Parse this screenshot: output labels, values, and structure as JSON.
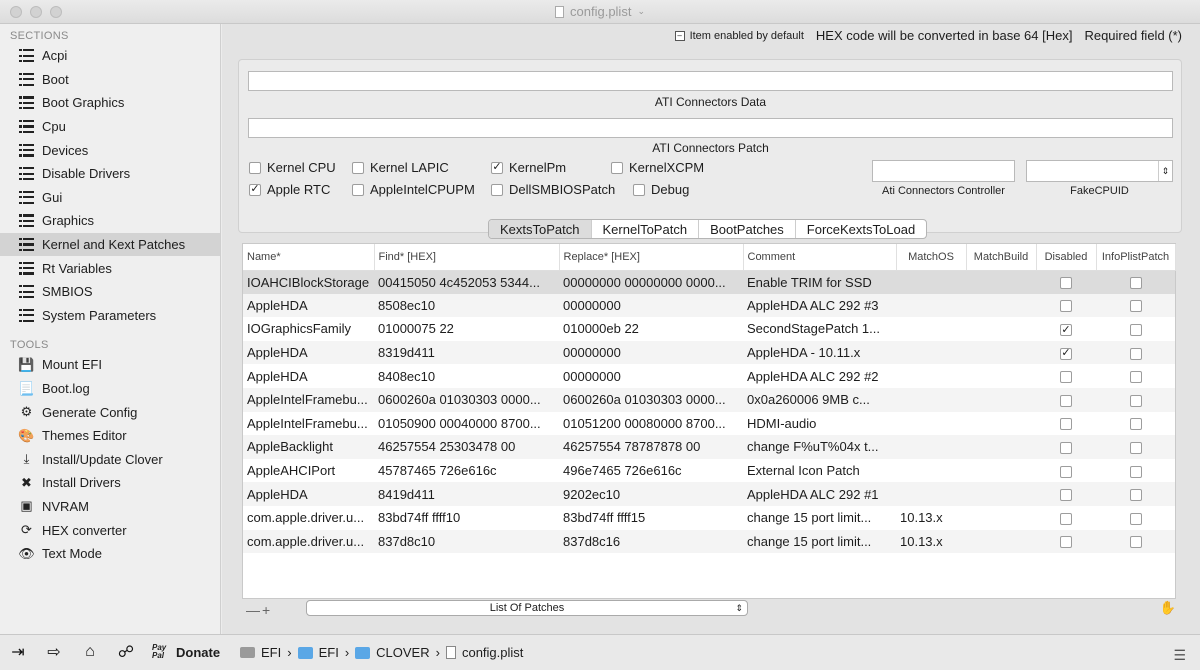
{
  "window": {
    "title": "config.plist"
  },
  "sidebar": {
    "sections_header": "SECTIONS",
    "sections": [
      {
        "label": "Acpi"
      },
      {
        "label": "Boot"
      },
      {
        "label": "Boot Graphics"
      },
      {
        "label": "Cpu"
      },
      {
        "label": "Devices"
      },
      {
        "label": "Disable Drivers"
      },
      {
        "label": "Gui"
      },
      {
        "label": "Graphics"
      },
      {
        "label": "Kernel and Kext Patches",
        "selected": true
      },
      {
        "label": "Rt Variables"
      },
      {
        "label": "SMBIOS"
      },
      {
        "label": "System Parameters"
      }
    ],
    "tools_header": "TOOLS",
    "tools": [
      {
        "label": "Mount EFI",
        "icon": "disk-icon"
      },
      {
        "label": "Boot.log",
        "icon": "log-icon"
      },
      {
        "label": "Generate Config",
        "icon": "gear-icon"
      },
      {
        "label": "Themes Editor",
        "icon": "palette-icon"
      },
      {
        "label": "Install/Update Clover",
        "icon": "install-icon"
      },
      {
        "label": "Install Drivers",
        "icon": "tools-icon"
      },
      {
        "label": "NVRAM",
        "icon": "chip-icon"
      },
      {
        "label": "HEX converter",
        "icon": "refresh-icon"
      },
      {
        "label": "Text Mode",
        "icon": "eye-icon"
      }
    ]
  },
  "header": {
    "enabled_default": "Item enabled by default",
    "hex_note": "HEX code will be converted in base 64 [Hex]",
    "required": "Required field (*)"
  },
  "ati": {
    "connectors_data_label": "ATI Connectors Data",
    "connectors_data_value": "",
    "connectors_patch_label": "ATI Connectors Patch",
    "connectors_patch_value": "",
    "controller_label": "Ati Connectors Controller",
    "controller_value": "",
    "fakecpuid_label": "FakeCPUID",
    "fakecpuid_value": ""
  },
  "checkboxes": [
    {
      "label": "Kernel CPU",
      "checked": false
    },
    {
      "label": "Kernel LAPIC",
      "checked": false
    },
    {
      "label": "KernelPm",
      "checked": true
    },
    {
      "label": "KernelXCPM",
      "checked": false
    },
    {
      "label": "Apple RTC",
      "checked": true
    },
    {
      "label": "AppleIntelCPUPM",
      "checked": false
    },
    {
      "label": "DellSMBIOSPatch",
      "checked": false
    },
    {
      "label": "Debug",
      "checked": false
    }
  ],
  "tabs": [
    {
      "label": "KextsToPatch",
      "active": true
    },
    {
      "label": "KernelToPatch"
    },
    {
      "label": "BootPatches"
    },
    {
      "label": "ForceKextsToLoad"
    }
  ],
  "table": {
    "columns": [
      "Name*",
      "Find* [HEX]",
      "Replace* [HEX]",
      "Comment",
      "MatchOS",
      "MatchBuild",
      "Disabled",
      "InfoPlistPatch"
    ],
    "rows": [
      {
        "name": "IOAHCIBlockStorage",
        "find": "00415050 4c452053 5344...",
        "replace": "00000000 00000000 0000...",
        "comment": "Enable TRIM for SSD",
        "matchos": "",
        "matchbuild": "",
        "disabled": false,
        "infoplist": false
      },
      {
        "name": "AppleHDA",
        "find": "8508ec10",
        "replace": "00000000",
        "comment": "AppleHDA ALC 292 #3",
        "matchos": "",
        "matchbuild": "",
        "disabled": false,
        "infoplist": false
      },
      {
        "name": "IOGraphicsFamily",
        "find": "01000075 22",
        "replace": "010000eb 22",
        "comment": "SecondStagePatch 1...",
        "matchos": "",
        "matchbuild": "",
        "disabled": true,
        "infoplist": false
      },
      {
        "name": "AppleHDA",
        "find": "8319d411",
        "replace": "00000000",
        "comment": "AppleHDA - 10.11.x",
        "matchos": "",
        "matchbuild": "",
        "disabled": true,
        "infoplist": false
      },
      {
        "name": "AppleHDA",
        "find": "8408ec10",
        "replace": "00000000",
        "comment": "AppleHDA ALC 292 #2",
        "matchos": "",
        "matchbuild": "",
        "disabled": false,
        "infoplist": false
      },
      {
        "name": "AppleIntelFramebu...",
        "find": "0600260a 01030303 0000...",
        "replace": "0600260a 01030303 0000...",
        "comment": "0x0a260006 9MB c...",
        "matchos": "",
        "matchbuild": "",
        "disabled": false,
        "infoplist": false
      },
      {
        "name": "AppleIntelFramebu...",
        "find": "01050900 00040000 8700...",
        "replace": "01051200 00080000 8700...",
        "comment": "HDMI-audio",
        "matchos": "",
        "matchbuild": "",
        "disabled": false,
        "infoplist": false
      },
      {
        "name": "AppleBacklight",
        "find": "46257554 25303478 00",
        "replace": "46257554 78787878 00",
        "comment": "change F%uT%04x t...",
        "matchos": "",
        "matchbuild": "",
        "disabled": false,
        "infoplist": false
      },
      {
        "name": "AppleAHCIPort",
        "find": "45787465 726e616c",
        "replace": "496e7465 726e616c",
        "comment": "External Icon Patch",
        "matchos": "",
        "matchbuild": "",
        "disabled": false,
        "infoplist": false
      },
      {
        "name": "AppleHDA",
        "find": "8419d411",
        "replace": "9202ec10",
        "comment": "AppleHDA ALC 292 #1",
        "matchos": "",
        "matchbuild": "",
        "disabled": false,
        "infoplist": false
      },
      {
        "name": "com.apple.driver.u...",
        "find": "83bd74ff ffff10",
        "replace": "83bd74ff ffff15",
        "comment": "change 15 port limit...",
        "matchos": "10.13.x",
        "matchbuild": "",
        "disabled": false,
        "infoplist": false
      },
      {
        "name": "com.apple.driver.u...",
        "find": "837d8c10",
        "replace": "837d8c16",
        "comment": "change 15 port limit...",
        "matchos": "10.13.x",
        "matchbuild": "",
        "disabled": false,
        "infoplist": false
      }
    ]
  },
  "bottom": {
    "add_remove": "—+",
    "popup": "List Of Patches"
  },
  "footer": {
    "paypal": "Pay Pal",
    "donate": "Donate",
    "path": [
      "EFI",
      "EFI",
      "CLOVER",
      "config.plist"
    ]
  }
}
